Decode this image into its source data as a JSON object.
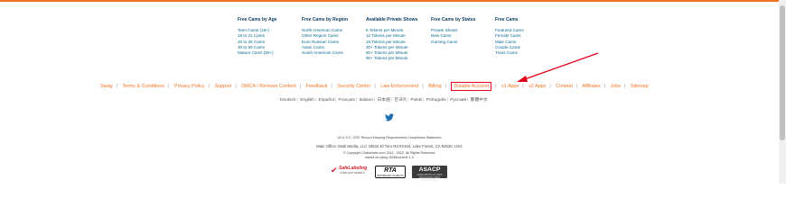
{
  "categories": [
    {
      "title": "Free Cams by Age",
      "links": [
        "Teen Cams (18+)",
        "18 to 21 Cams",
        "20 to 30 Cams",
        "30 to 50 Cams",
        "Mature Cams (50+)"
      ]
    },
    {
      "title": "Free Cams by Region",
      "links": [
        "North American Cams",
        "Other Region Cams",
        "Euro Russian Cams",
        "Asian Cams",
        "South American Cams"
      ]
    },
    {
      "title": "Available Private Shows",
      "links": [
        "6 Tokens per Minute",
        "12 Tokens per Minute",
        "18 Tokens per Minute",
        "30+ Tokens per Minute",
        "60+ Tokens per Minute",
        "90+ Tokens per Minute"
      ]
    },
    {
      "title": "Free Cams by Status",
      "links": [
        "Private Shows",
        "New Cams",
        "Gaming Cams"
      ]
    },
    {
      "title": "Free Cams",
      "links": [
        "Featured Cams",
        "Female Cams",
        "Male Cams",
        "Couple Cams",
        "Trans Cams"
      ]
    }
  ],
  "footer_links": [
    "Swag",
    "Terms & Conditions",
    "Privacy Policy",
    "Support",
    "DMCA / Remove Content",
    "Feedback",
    "Security Center",
    "Law Enforcement",
    "Billing",
    "Disable Account",
    "v1 Apps",
    "v2 Apps",
    "Contest",
    "Affiliates",
    "Jobs",
    "Sitemap"
  ],
  "highlighted_link_index": 9,
  "languages": [
    "Deutsch",
    "English",
    "Español",
    "Français",
    "Italiano",
    "日本語",
    "한국어",
    "Polski",
    "Português",
    "Русский",
    "繁體中文"
  ],
  "legal": {
    "compliance": "18 U.S.C. 2257 Record Keeping Requirements Compliance Statement",
    "office": "Main Office: Multi Media, LLC 23615 El Toro Rd #X344, Lake Forest, CA 92630, USA",
    "copyright": "© Copyright Chaturbate.com 2011 - 2022. All Rights Reserved.",
    "build": "www3.ed-q6hg-1f33fbca1e4f-1-3"
  },
  "badges": {
    "safelabeling": {
      "title": "SafeLabeling",
      "sub": "COMPLIANT WEBSITE"
    },
    "rta": {
      "title": "RTA",
      "sub": "RESTRICTED TO ADULTS"
    },
    "asacp": {
      "title": "ASACP",
      "sub": "ASSOCIATION OF SITES ADVOCATING CHILD PROTECTION"
    }
  },
  "colors": {
    "accent": "#f47321",
    "link": "#0a6c92",
    "highlight": "#e3001b",
    "twitter": "#1d6fb3"
  },
  "icons": {
    "social": "twitter-icon"
  }
}
